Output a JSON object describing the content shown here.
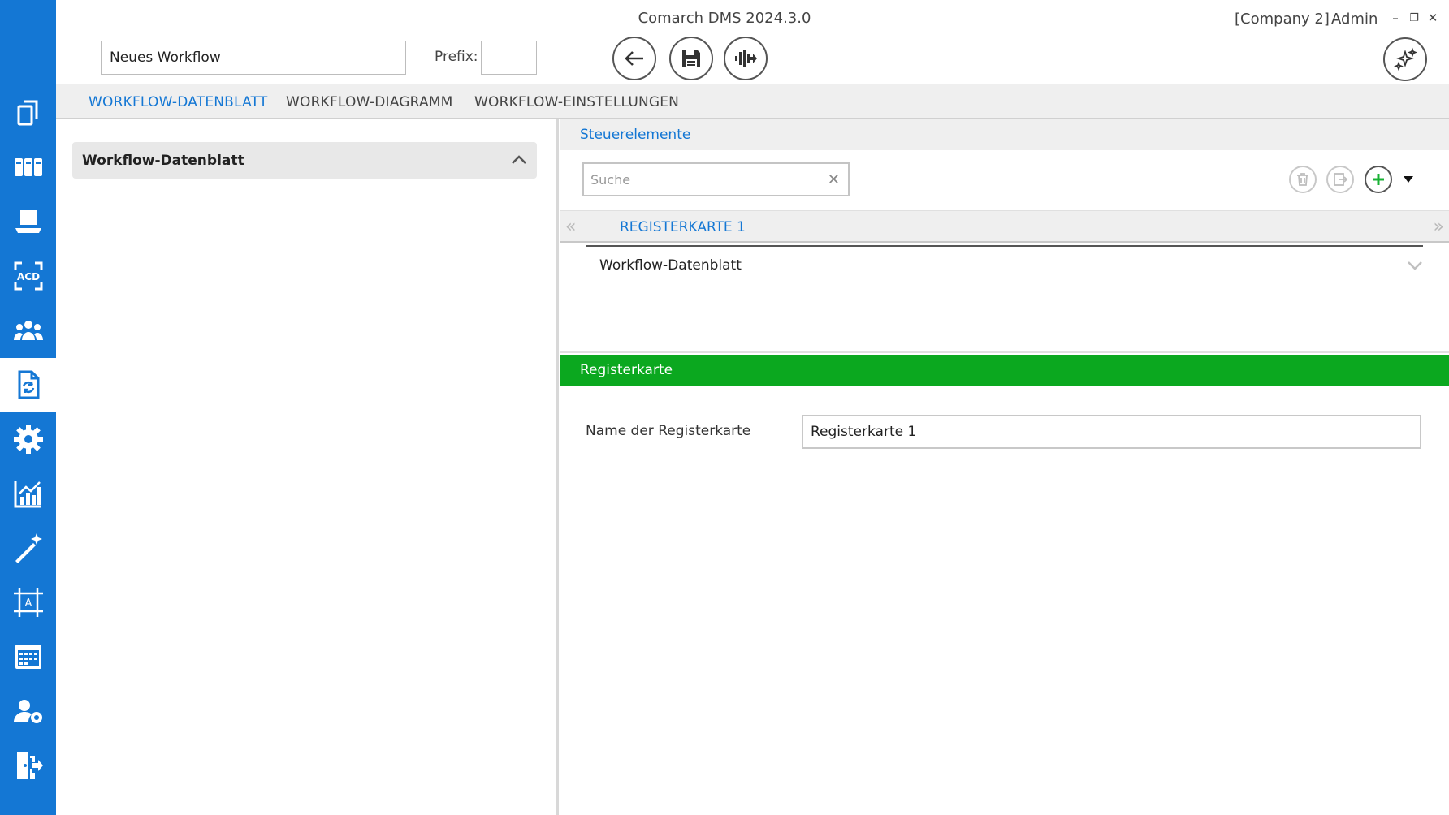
{
  "app": {
    "title": "Comarch DMS 2024.3.0",
    "company": "[Company 2]",
    "user": "Admin"
  },
  "window_controls": {
    "minimize": "–",
    "restore": "❐",
    "close": "✕"
  },
  "header": {
    "workflow_name": "Neues Workflow",
    "prefix_label": "Prefix:",
    "prefix_value": ""
  },
  "sidebar": {
    "items": [
      {
        "name": "documents-icon"
      },
      {
        "name": "repository-icon"
      },
      {
        "name": "workstation-icon"
      },
      {
        "name": "ocr-icon"
      },
      {
        "name": "users-icon"
      },
      {
        "name": "workflow-icon",
        "active": true
      },
      {
        "name": "settings-icon"
      },
      {
        "name": "reports-icon"
      },
      {
        "name": "wizard-icon"
      },
      {
        "name": "template-icon"
      },
      {
        "name": "calendar-icon"
      },
      {
        "name": "user-settings-icon"
      },
      {
        "name": "logout-icon"
      }
    ]
  },
  "tabs": [
    {
      "label": "WORKFLOW-DATENBLATT",
      "active": true
    },
    {
      "label": "WORKFLOW-DIAGRAMM",
      "active": false
    },
    {
      "label": "WORKFLOW-EINSTELLUNGEN",
      "active": false
    }
  ],
  "left_panel": {
    "section_title": "Workflow-Datenblatt"
  },
  "controls_panel": {
    "title": "Steuerelemente",
    "search_placeholder": "Suche",
    "search_value": "",
    "register_tab": "REGISTERKARTE 1",
    "nav_prev": "«",
    "nav_next": "»",
    "row_label": "Workflow-Datenblatt"
  },
  "properties_panel": {
    "title": "Registerkarte",
    "field_label": "Name der Registerkarte",
    "field_value": "Registerkarte 1"
  },
  "colors": {
    "brand_blue": "#1477d4",
    "header_green": "#0ba81f",
    "add_green": "#18b234"
  }
}
